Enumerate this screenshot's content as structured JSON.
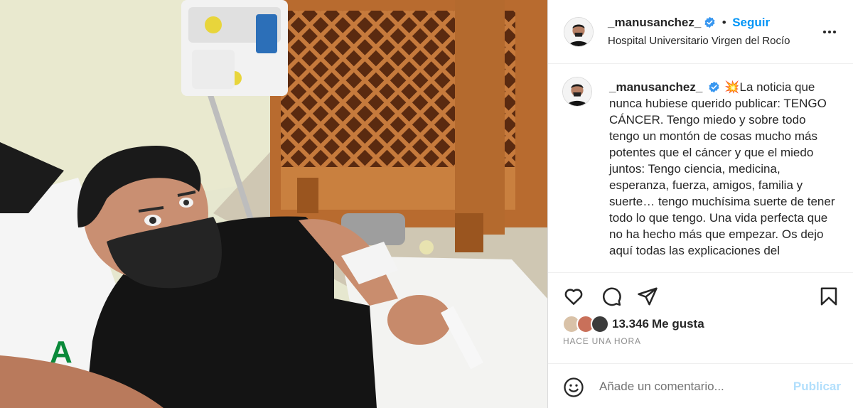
{
  "post": {
    "username": "_manusanchez_",
    "verified": true,
    "follow_label": "Seguir",
    "location": "Hospital Universitario Virgen del Rocío",
    "caption_emoji": "💥",
    "caption": "La noticia que nunca hubiese querido publicar: TENGO CÁNCER. Tengo miedo y sobre todo tengo un montón de cosas mucho más potentes que el cáncer y que el miedo juntos: Tengo ciencia, medicina, esperanza, fuerza, amigos, familia y suerte… tengo muchísima suerte de tener todo lo que tengo. Una vida perfecta que no ha hecho más que empezar. Os dejo aquí todas las explicaciones del",
    "likes_count": "13.346",
    "likes_label": "Me gusta",
    "time": "HACE UNA HORA"
  },
  "comment": {
    "placeholder": "Añade un comentario...",
    "publish_label": "Publicar"
  },
  "icons": {
    "verified": "verified-badge-icon",
    "more": "more-options-icon",
    "like": "heart-icon",
    "comment": "comment-bubble-icon",
    "share": "paper-plane-icon",
    "save": "bookmark-icon",
    "emoji": "smiley-icon"
  },
  "colors": {
    "accent": "#0095f6",
    "verified": "#3897f0",
    "publish_disabled": "#b2dffc",
    "secondary_text": "#8e8e8e"
  }
}
